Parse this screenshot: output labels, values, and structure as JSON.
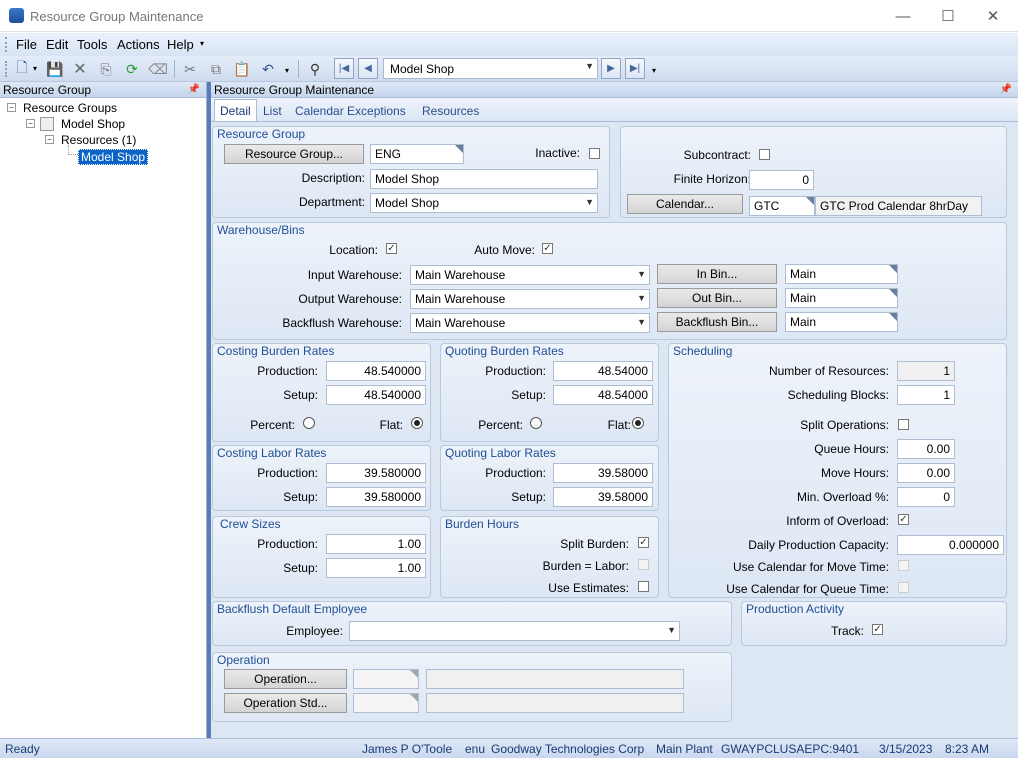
{
  "window": {
    "title": "Resource Group Maintenance",
    "minimize": "—",
    "maximize": "☐",
    "close": "✕"
  },
  "menu": {
    "file": "File",
    "edit": "Edit",
    "tools": "Tools",
    "actions": "Actions",
    "help": "Help"
  },
  "toolbar": {
    "record_combo": "Model Shop"
  },
  "tree": {
    "panel_title": "Resource Group",
    "root": "Resource Groups",
    "group": "Model Shop",
    "resources": "Resources (1)",
    "selected": "Model Shop"
  },
  "main": {
    "panel_title": "Resource Group Maintenance",
    "tabs": [
      "Detail",
      "List",
      "Calendar Exceptions",
      "Resources"
    ]
  },
  "resource_group": {
    "title": "Resource Group",
    "button": "Resource Group...",
    "id": "ENG",
    "inactive_label": "Inactive:",
    "description_label": "Description:",
    "description": "Model Shop",
    "department_label": "Department:",
    "department": "Model Shop"
  },
  "right_top": {
    "subcontract_label": "Subcontract:",
    "finite_label": "Finite Horizon:",
    "finite_value": "0",
    "calendar_button": "Calendar...",
    "calendar_id": "GTC",
    "calendar_desc": "GTC Prod Calendar 8hrDay"
  },
  "warehouse": {
    "title": "Warehouse/Bins",
    "location_label": "Location:",
    "auto_move_label": "Auto Move:",
    "input_label": "Input Warehouse:",
    "input_value": "Main Warehouse",
    "output_label": "Output Warehouse:",
    "output_value": "Main Warehouse",
    "backflush_label": "Backflush Warehouse:",
    "backflush_value": "Main Warehouse",
    "in_bin_button": "In Bin...",
    "in_bin": "Main",
    "out_bin_button": "Out Bin...",
    "out_bin": "Main",
    "bf_bin_button": "Backflush Bin...",
    "bf_bin": "Main"
  },
  "costing_burden": {
    "title": "Costing Burden Rates",
    "production_label": "Production:",
    "production": "48.540000",
    "setup_label": "Setup:",
    "setup": "48.540000",
    "percent_label": "Percent:",
    "flat_label": "Flat:"
  },
  "quoting_burden": {
    "title": "Quoting Burden Rates",
    "production_label": "Production:",
    "production": "48.54000",
    "setup_label": "Setup:",
    "setup": "48.54000",
    "percent_label": "Percent:",
    "flat_label": "Flat:"
  },
  "costing_labor": {
    "title": "Costing Labor Rates",
    "production_label": "Production:",
    "production": "39.580000",
    "setup_label": "Setup:",
    "setup": "39.580000"
  },
  "quoting_labor": {
    "title": "Quoting Labor Rates",
    "production_label": "Production:",
    "production": "39.58000",
    "setup_label": "Setup:",
    "setup": "39.58000"
  },
  "crew": {
    "title": "Crew Sizes",
    "production_label": "Production:",
    "production": "1.00",
    "setup_label": "Setup:",
    "setup": "1.00"
  },
  "burden_hours": {
    "title": "Burden Hours",
    "split_label": "Split Burden:",
    "equal_label": "Burden = Labor:",
    "estimates_label": "Use Estimates:"
  },
  "scheduling": {
    "title": "Scheduling",
    "num_res_label": "Number of Resources:",
    "num_res": "1",
    "blocks_label": "Scheduling Blocks:",
    "blocks": "1",
    "split_label": "Split Operations:",
    "queue_label": "Queue Hours:",
    "queue": "0.00",
    "move_label": "Move Hours:",
    "move": "0.00",
    "overload_label": "Min. Overload %:",
    "overload": "0",
    "inform_label": "Inform of Overload:",
    "daily_label": "Daily Production Capacity:",
    "daily": "0.000000",
    "cal_move_label": "Use Calendar for Move Time:",
    "cal_queue_label": "Use Calendar for Queue Time:"
  },
  "backflush_emp": {
    "title": "Backflush Default Employee",
    "employee_label": "Employee:",
    "employee": ""
  },
  "prod_activity": {
    "title": "Production Activity",
    "track_label": "Track:"
  },
  "operation": {
    "title": "Operation",
    "op_button": "Operation...",
    "std_button": "Operation Std..."
  },
  "status": {
    "ready": "Ready",
    "user": "James P O'Toole",
    "lang": "enu",
    "company": "Goodway Technologies Corp",
    "plant": "Main Plant",
    "server": "GWAYPCLUSAEPC:9401",
    "date": "3/15/2023",
    "time": "8:23 AM"
  }
}
